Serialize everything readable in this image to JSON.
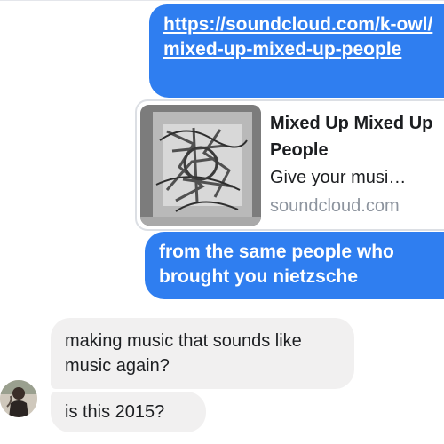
{
  "conversation": {
    "link_message": {
      "url": "https://soundcloud.com/k-owl/mixed-up-mixed-up-people"
    },
    "link_preview": {
      "title": "Mixed Up Mixed Up People",
      "description": "Give your musi…",
      "domain": "soundcloud.com",
      "thumbnail_icon": "album-art-thumbnail"
    },
    "outgoing_message": {
      "text": "from the same people who brought you nietzsche"
    },
    "incoming_messages": [
      {
        "text": "making music that sounds like music again?"
      },
      {
        "text": "is this 2015?"
      }
    ],
    "sender_avatar_icon": "contact-avatar"
  },
  "colors": {
    "outgoing_bubble": "#2f7ef0",
    "incoming_bubble": "#f1f0f0",
    "domain_text": "#8d949e"
  }
}
